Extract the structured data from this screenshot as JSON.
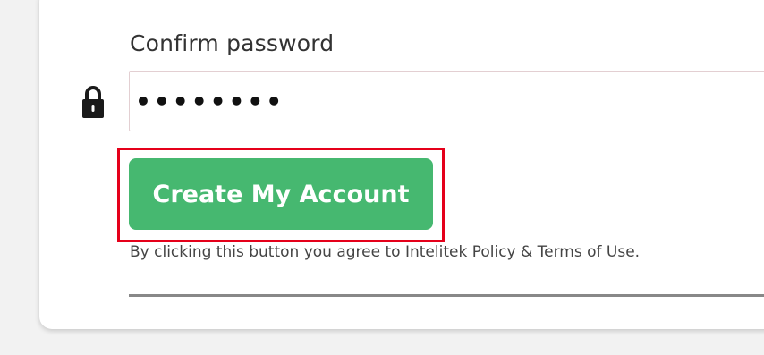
{
  "form": {
    "confirm_label": "Confirm password",
    "confirm_value": "••••••••",
    "submit_label": "Create My Account",
    "terms_text": "By clicking this button you agree to Intelitek ",
    "terms_link": "Policy & Terms of Use."
  },
  "icons": {
    "password": "lock-icon"
  },
  "colors": {
    "button": "#46b870",
    "highlight": "#e5001a",
    "input_border": "#e3cfd2"
  }
}
